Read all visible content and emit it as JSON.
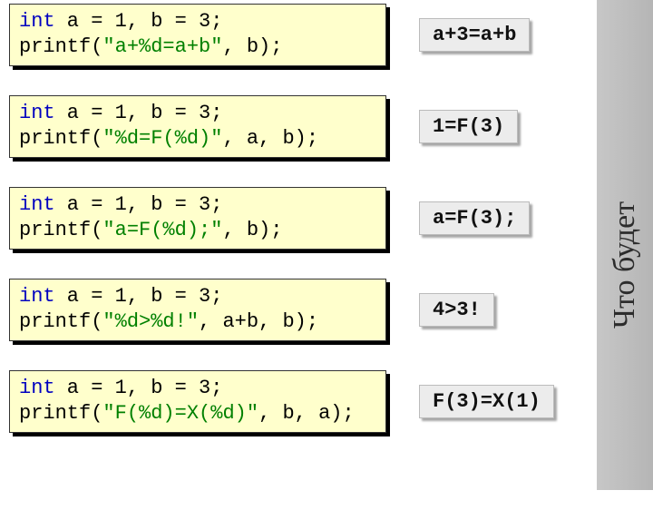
{
  "sidebar": {
    "title": "Что будет"
  },
  "items": [
    {
      "code_html": "<span class=\"k\">int</span> a = 1, b = 3;\nprintf(<span class=\"s\">\"a+%d=a+b\"</span>, b);",
      "answer": "a+3=a+b"
    },
    {
      "code_html": "<span class=\"k\">int</span> a = 1, b = 3;\nprintf(<span class=\"s\">\"%d=F(%d)\"</span>, a, b);",
      "answer": "1=F(3)"
    },
    {
      "code_html": "<span class=\"k\">int</span> a = 1, b = 3;\nprintf(<span class=\"s\">\"a=F(%d);\"</span>, b);",
      "answer": "a=F(3);"
    },
    {
      "code_html": "<span class=\"k\">int</span> a = 1, b = 3;\nprintf(<span class=\"s\">\"%d>%d!\"</span>, a+b, b);",
      "answer": "4>3!"
    },
    {
      "code_html": "<span class=\"k\">int</span> a = 1, b = 3;\nprintf(<span class=\"s\">\"F(%d)=X(%d)\"</span>, b, a);",
      "answer": "F(3)=X(1)"
    }
  ]
}
